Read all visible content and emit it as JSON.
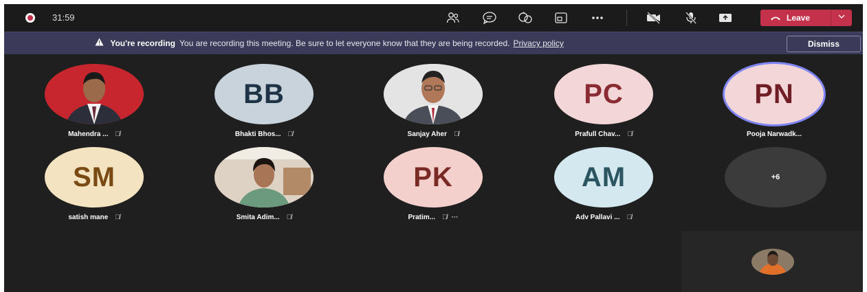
{
  "call": {
    "timer": "31:59",
    "leave_label": "Leave"
  },
  "toolbar": {
    "icons": [
      "people-icon",
      "chat-icon",
      "reactions-icon",
      "rooms-icon",
      "more-icon",
      "camera-off-icon",
      "mic-off-icon",
      "share-icon"
    ]
  },
  "banner": {
    "title": "You're recording",
    "message": "You are recording this meeting. Be sure to let everyone know that they are being recorded.",
    "link": "Privacy policy",
    "dismiss_label": "Dismiss"
  },
  "participants": [
    {
      "name": "Mahendra ...",
      "initials": "",
      "photo": true,
      "bg": "#7a1f24"
    },
    {
      "name": "Bhakti Bhos...",
      "initials": "BB",
      "photo": false,
      "bg": "#c8d3dc",
      "fg": "#1f3347"
    },
    {
      "name": "Sanjay Aher",
      "initials": "",
      "photo": true,
      "bg": "#d9d9d9"
    },
    {
      "name": "Prafull Chav...",
      "initials": "PC",
      "photo": false,
      "bg": "#f3d6d8",
      "fg": "#8a2b33"
    },
    {
      "name": "Pooja Narwadk...",
      "initials": "PN",
      "photo": false,
      "bg": "#f3d6d8",
      "fg": "#6e1e24",
      "active": true
    },
    {
      "name": "satish mane",
      "initials": "SM",
      "photo": false,
      "bg": "#f4e3c0",
      "fg": "#7a4a14"
    },
    {
      "name": "Smita Adim...",
      "initials": "",
      "photo": true,
      "bg": "#c9b3a0"
    },
    {
      "name": "Pratim...",
      "initials": "PK",
      "photo": false,
      "bg": "#f3d0cc",
      "fg": "#7a2a25",
      "more": true
    },
    {
      "name": "Adv Pallavi ...",
      "initials": "AM",
      "photo": false,
      "bg": "#d3e9ef",
      "fg": "#2b5561"
    }
  ],
  "overflow_label": "+6",
  "colors": {
    "accent": "#c4314b",
    "banner": "#3b3a58",
    "active_ring": "#7f85f5"
  }
}
